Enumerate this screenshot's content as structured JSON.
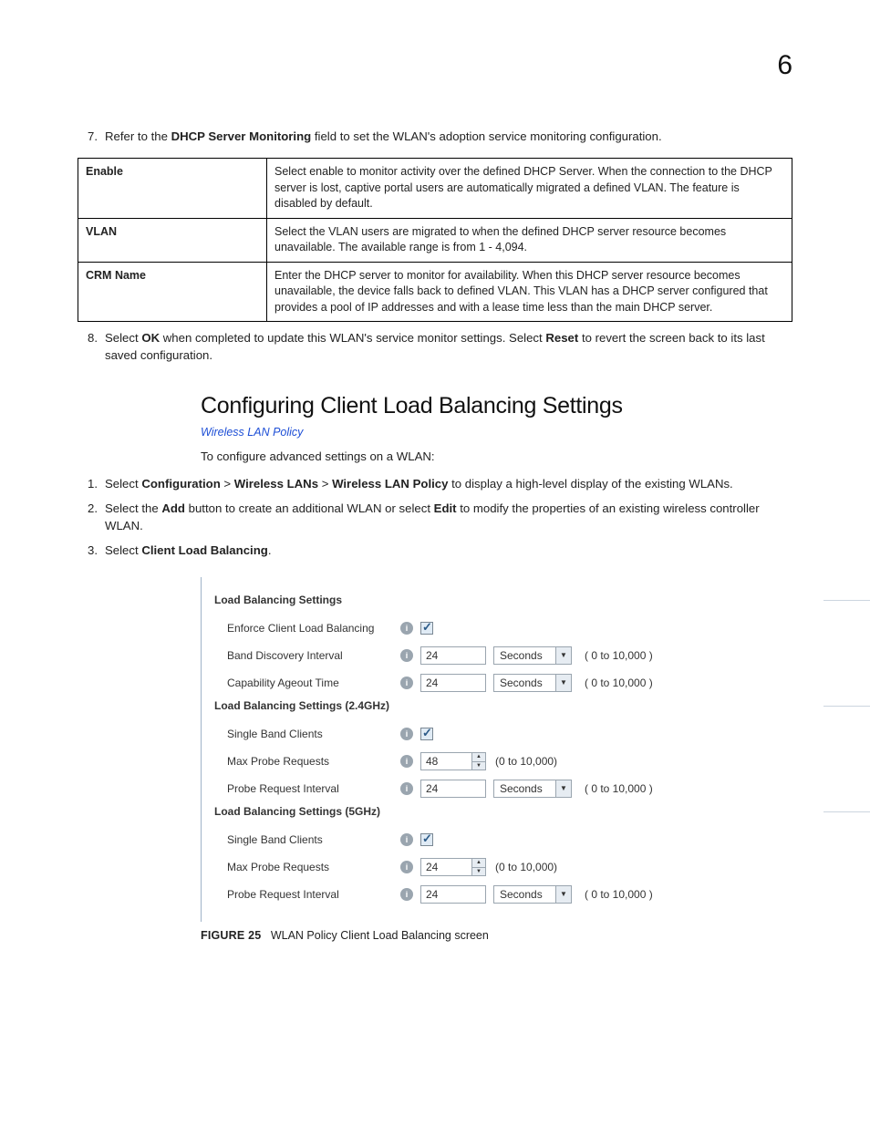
{
  "page_number": "6",
  "step7": {
    "num": "7.",
    "pre": "Refer to the ",
    "bold": "DHCP Server Monitoring",
    "post": " field to set the WLAN's adoption service monitoring configuration."
  },
  "table": [
    {
      "key": "Enable",
      "val": "Select enable to monitor activity over the defined DHCP Server. When the connection to the DHCP server is lost, captive portal users are automatically migrated a defined VLAN. The feature is disabled by default."
    },
    {
      "key": "VLAN",
      "val": "Select the VLAN users are migrated to when the defined DHCP server resource becomes unavailable. The available range is from 1 - 4,094."
    },
    {
      "key": "CRM Name",
      "val": "Enter the DHCP server to monitor for availability. When this DHCP server resource becomes unavailable, the device falls back to defined VLAN. This VLAN has a DHCP server configured that provides a pool of IP addresses and with a lease time less than the main DHCP server."
    }
  ],
  "step8": {
    "num": "8.",
    "p1": "Select ",
    "ok": "OK",
    "p2": " when completed to update this WLAN's service monitor settings. Select ",
    "reset": "Reset",
    "p3": " to revert the screen back to its last saved configuration."
  },
  "heading": "Configuring Client Load Balancing Settings",
  "crumb": "Wireless LAN Policy",
  "intro": "To configure advanced settings on a WLAN:",
  "step1": {
    "num": "1.",
    "p1": "Select ",
    "b1": "Configuration",
    "s1": " > ",
    "b2": "Wireless LANs",
    "s2": " > ",
    "b3": "Wireless LAN Policy",
    "p2": " to display a high-level display of the existing WLANs."
  },
  "step2": {
    "num": "2.",
    "p1": "Select the ",
    "b1": "Add",
    "p2": " button to create an additional WLAN or select ",
    "b2": "Edit",
    "p3": " to modify the properties of an existing wireless controller WLAN."
  },
  "step3": {
    "num": "3.",
    "p1": "Select ",
    "b1": "Client Load Balancing",
    "p2": "."
  },
  "form": {
    "g1": {
      "title": "Load Balancing Settings",
      "enforce_label": "Enforce Client Load Balancing",
      "band_discovery_label": "Band Discovery Interval",
      "band_discovery_value": "24",
      "cap_ageout_label": "Capability Ageout Time",
      "cap_ageout_value": "24"
    },
    "g2": {
      "title": "Load Balancing Settings (2.4GHz)",
      "single_band_label": "Single Band Clients",
      "max_probe_label": "Max Probe Requests",
      "max_probe_value": "48",
      "probe_interval_label": "Probe Request Interval",
      "probe_interval_value": "24"
    },
    "g3": {
      "title": "Load Balancing Settings (5GHz)",
      "single_band_label": "Single Band Clients",
      "max_probe_label": "Max Probe Requests",
      "max_probe_value": "24",
      "probe_interval_label": "Probe Request Interval",
      "probe_interval_value": "24"
    },
    "unit_seconds": "Seconds",
    "range_hint": "( 0 to 10,000 )",
    "range_hint_plain": "(0 to 10,000)",
    "info_glyph": "i"
  },
  "figure": {
    "label": "FIGURE 25",
    "caption": "WLAN Policy Client Load Balancing screen"
  }
}
